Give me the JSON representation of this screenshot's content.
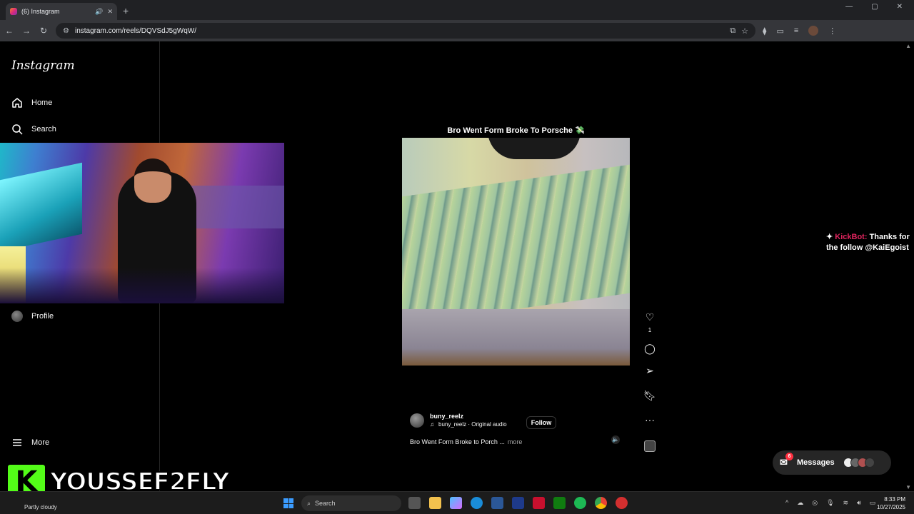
{
  "browser": {
    "tab_title": "(6) Instagram",
    "url": "instagram.com/reels/DQVSdJ5gWqW/"
  },
  "sidebar": {
    "logo": "Instagram",
    "items": [
      {
        "label": "Home",
        "icon": "home-icon"
      },
      {
        "label": "Search",
        "icon": "search-icon"
      },
      {
        "label": "Profile",
        "icon": "avatar"
      },
      {
        "label": "More",
        "icon": "hamburger-icon"
      }
    ]
  },
  "reel": {
    "title": "Bro Went Form Broke To Porsche 💸",
    "like_count": "1",
    "author": "buny_reelz",
    "audio": "buny_reelz · Original audio",
    "follow_label": "Follow",
    "caption": "Bro Went Form Broke to Porch ...",
    "more_label": "more"
  },
  "chat": {
    "bot_name": "KickBot:",
    "message": "Thanks for the follow @KaiEgoist"
  },
  "messages": {
    "label": "Messages",
    "badge": "6"
  },
  "overlay": {
    "k_logo": "K",
    "streamer_name": "YOUSSEF2FLY"
  },
  "taskbar": {
    "weather": "Partly cloudy",
    "search_placeholder": "Search",
    "time": "8:33 PM",
    "date": "10/27/2025"
  },
  "colors": {
    "kick_green": "#53fc18",
    "notification_red": "#ff3040",
    "ig_bg": "#000000"
  }
}
